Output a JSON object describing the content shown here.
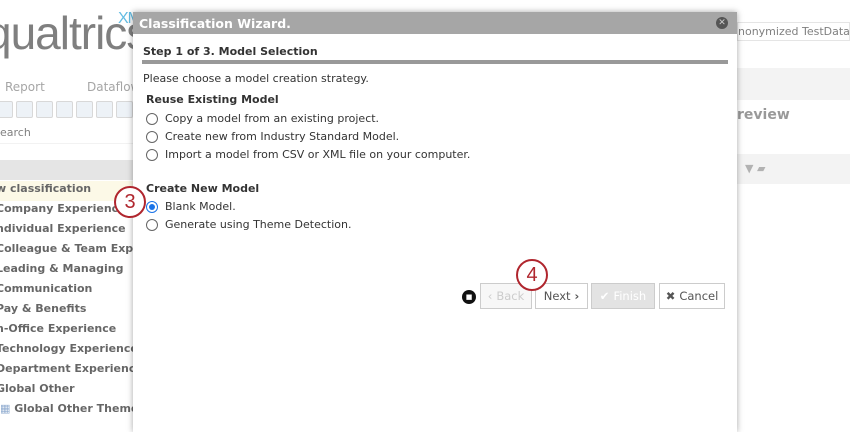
{
  "app": {
    "logo": "qualtrics",
    "logo_suffix": "XM",
    "tabs": [
      "Report",
      "Dataflow"
    ],
    "search_label": "earch",
    "project": "nonymized TestData",
    "panel_title": "review"
  },
  "tree": [
    "w classification",
    "Company Experience",
    "ndividual Experience",
    "Colleague & Team Experie",
    "Leading & Managing",
    "Communication",
    "Pay & Benefits",
    "n-Office Experience",
    "Technology Experience",
    "Department Experience",
    "Global Other",
    "Global Other Themes"
  ],
  "dialog": {
    "title": "Classification Wizard.",
    "step": "Step 1 of 3. Model Selection",
    "intro": "Please choose a model creation strategy.",
    "reuse_heading": "Reuse Existing Model",
    "reuse_options": [
      "Copy a model from an existing project.",
      "Create new from Industry Standard Model.",
      "Import a model from CSV or XML file on your computer."
    ],
    "create_heading": "Create New Model",
    "create_options": [
      "Blank Model.",
      "Generate using Theme Detection."
    ],
    "selected": "Blank Model.",
    "buttons": {
      "back": "Back",
      "next": "Next",
      "finish": "Finish",
      "cancel": "Cancel"
    }
  },
  "callouts": [
    "3",
    "4"
  ]
}
